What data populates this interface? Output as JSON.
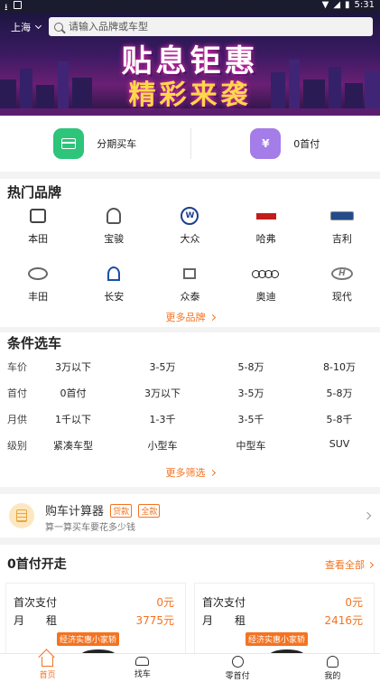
{
  "status_bar": {
    "time": "5:31",
    "icons": [
      "download-icon",
      "image-icon",
      "wifi-icon",
      "signal-icon",
      "battery-icon"
    ]
  },
  "header": {
    "city": "上海",
    "search_placeholder": "请输入品牌或车型"
  },
  "banner": {
    "line1": "贴息钜惠",
    "line2": "精彩来袭"
  },
  "quick_entries": [
    {
      "label": "分期买车",
      "icon": "card-icon",
      "color": "#2ec47a"
    },
    {
      "label": "0首付",
      "icon": "yen-icon",
      "color": "#a47de8"
    }
  ],
  "hot_brands": {
    "title": "热门品牌",
    "items": [
      {
        "name": "本田",
        "icon": "honda-logo"
      },
      {
        "name": "宝骏",
        "icon": "baojun-logo"
      },
      {
        "name": "大众",
        "icon": "volkswagen-logo"
      },
      {
        "name": "哈弗",
        "icon": "haval-logo"
      },
      {
        "name": "吉利",
        "icon": "geely-logo"
      },
      {
        "name": "丰田",
        "icon": "toyota-logo"
      },
      {
        "name": "长安",
        "icon": "changan-logo"
      },
      {
        "name": "众泰",
        "icon": "zotye-logo"
      },
      {
        "name": "奥迪",
        "icon": "audi-logo"
      },
      {
        "name": "现代",
        "icon": "hyundai-logo"
      }
    ],
    "logo_text": {
      "vw": "W",
      "hyundai": "H"
    },
    "more": "更多品牌"
  },
  "condition": {
    "title": "条件选车",
    "rows": [
      {
        "label": "车价",
        "options": [
          "3万以下",
          "3-5万",
          "5-8万",
          "8-10万"
        ]
      },
      {
        "label": "首付",
        "options": [
          "0首付",
          "3万以下",
          "3-5万",
          "5-8万"
        ]
      },
      {
        "label": "月供",
        "options": [
          "1千以下",
          "1-3千",
          "3-5千",
          "5-8千"
        ]
      },
      {
        "label": "级别",
        "options": [
          "紧凑车型",
          "小型车",
          "中型车",
          "SUV"
        ]
      }
    ],
    "more": "更多筛选"
  },
  "calculator": {
    "title": "购车计算器",
    "tags": [
      "贷款",
      "全款"
    ],
    "subtitle": "算一算买车要花多少钱"
  },
  "zero_down": {
    "title": "0首付开走",
    "view_all": "查看全部",
    "offers": [
      {
        "first_pay_label": "首次支付",
        "first_pay": "0元",
        "rent_label": "月　　租",
        "rent": "3775元",
        "badge": "经济实惠小家轿"
      },
      {
        "first_pay_label": "首次支付",
        "first_pay": "0元",
        "rent_label": "月　　租",
        "rent": "2416元",
        "badge": "经济实惠小家轿"
      }
    ]
  },
  "tabbar": {
    "tabs": [
      {
        "label": "首页",
        "icon": "home-icon",
        "active": true
      },
      {
        "label": "找车",
        "icon": "car-icon",
        "active": false
      },
      {
        "label": "零首付",
        "icon": "coin-icon",
        "active": false
      },
      {
        "label": "我的",
        "icon": "user-icon",
        "active": false
      }
    ],
    "accent": "#f37321"
  }
}
